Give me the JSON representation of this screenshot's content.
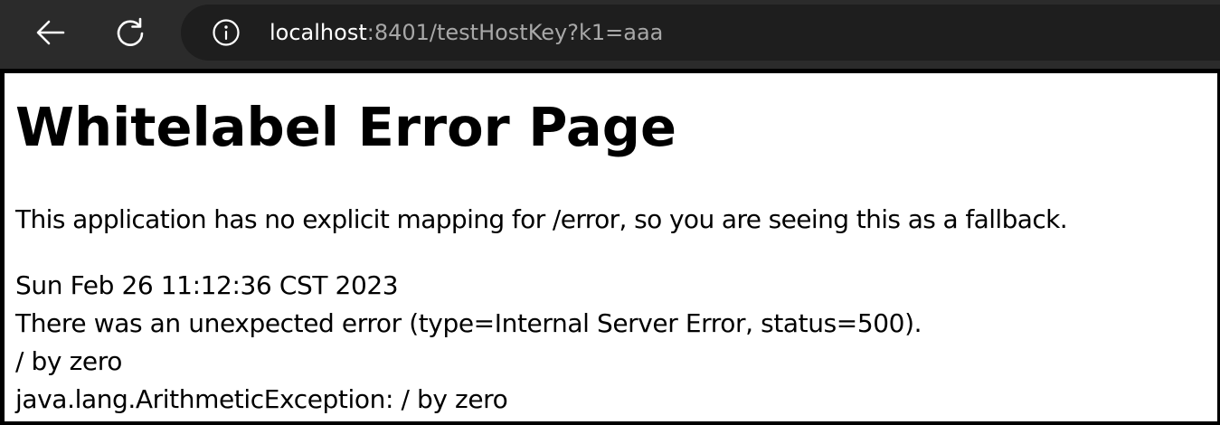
{
  "browser": {
    "back_icon": "arrow-left-icon",
    "reload_icon": "reload-icon",
    "site_info_icon": "info-icon",
    "url_host": "localhost",
    "url_rest": ":8401/testHostKey?k1=aaa",
    "chrome_bg": "#2b2b2b",
    "address_bar_bg": "#1e1e1e"
  },
  "page": {
    "title": "Whitelabel Error Page",
    "explanation": "This application has no explicit mapping for /error, so you are seeing this as a fallback.",
    "timestamp": "Sun Feb 26 11:12:36 CST 2023",
    "error_summary": "There was an unexpected error (type=Internal Server Error, status=500).",
    "error_message": "/ by zero",
    "exception": "java.lang.ArithmeticException: / by zero"
  }
}
